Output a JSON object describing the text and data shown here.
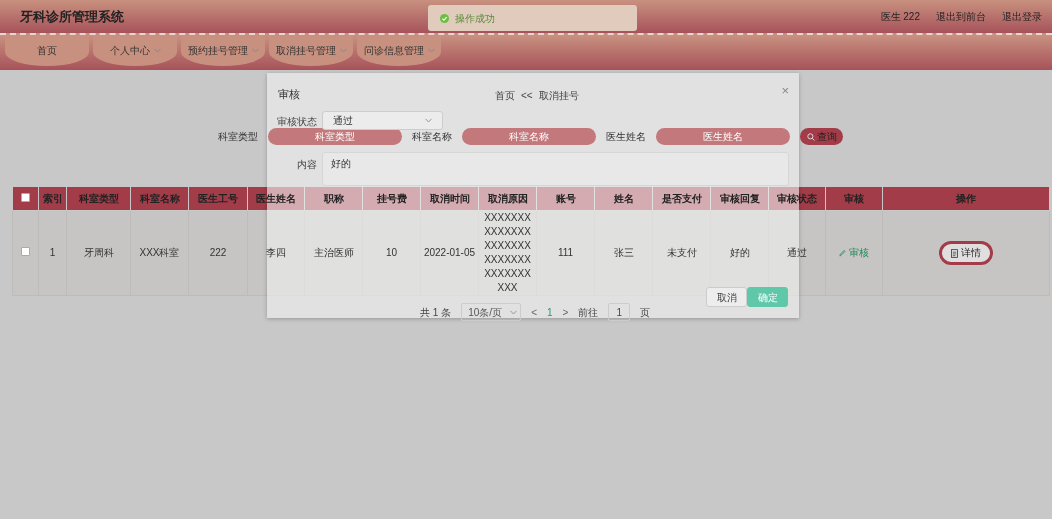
{
  "header": {
    "title": "牙科诊所管理系统",
    "user_links": [
      "医生 222",
      "退出到前台",
      "退出登录"
    ]
  },
  "toast": {
    "text": "操作成功"
  },
  "nav": [
    {
      "label": "首页",
      "dropdown": false
    },
    {
      "label": "个人中心",
      "dropdown": true
    },
    {
      "label": "预约挂号管理",
      "dropdown": true
    },
    {
      "label": "取消挂号管理",
      "dropdown": true
    },
    {
      "label": "问诊信息管理",
      "dropdown": true
    }
  ],
  "breadcrumb": {
    "home": "首页",
    "separator": "<<",
    "current": "取消挂号"
  },
  "search": {
    "fields": [
      {
        "label": "科室类型",
        "placeholder": "科室类型"
      },
      {
        "label": "科室名称",
        "placeholder": "科室名称"
      },
      {
        "label": "医生姓名",
        "placeholder": "医生姓名"
      }
    ],
    "button": "查询"
  },
  "table": {
    "select_all": {
      "checked": false
    },
    "columns": [
      "索引",
      "科室类型",
      "科室名称",
      "医生工号",
      "医生姓名",
      "职称",
      "挂号费",
      "取消时间",
      "取消原因",
      "账号",
      "姓名",
      "是否支付",
      "审核回复",
      "审核状态",
      "审核",
      "操作"
    ],
    "rows": [
      {
        "selected": false,
        "cells": [
          "1",
          "牙周科",
          "XXX科室",
          "222",
          "李四",
          "主治医师",
          "10",
          "2022-01-05",
          "XXXXXXXXXXXXXXXXXXXXXXXXXXXXXXXXXXXXXX",
          "111",
          "张三",
          "未支付",
          "好的",
          "通过"
        ],
        "audit_link": "审核",
        "detail_button": "详情"
      }
    ]
  },
  "pagination": {
    "total": "共 1 条",
    "page_size": "10条/页",
    "prev": "<",
    "pages": [
      {
        "label": "1",
        "selected": true
      }
    ],
    "next": ">",
    "goto_label": "前往",
    "goto_value": "1",
    "goto_suffix": "页"
  },
  "modal": {
    "title": "审核",
    "close": "×",
    "status": {
      "label": "审核状态",
      "value": "通过"
    },
    "content": {
      "label": "内容",
      "value": "好的"
    },
    "buttons": [
      {
        "label": "取消",
        "kind": "default"
      },
      {
        "label": "确定",
        "kind": "primary"
      }
    ]
  }
}
